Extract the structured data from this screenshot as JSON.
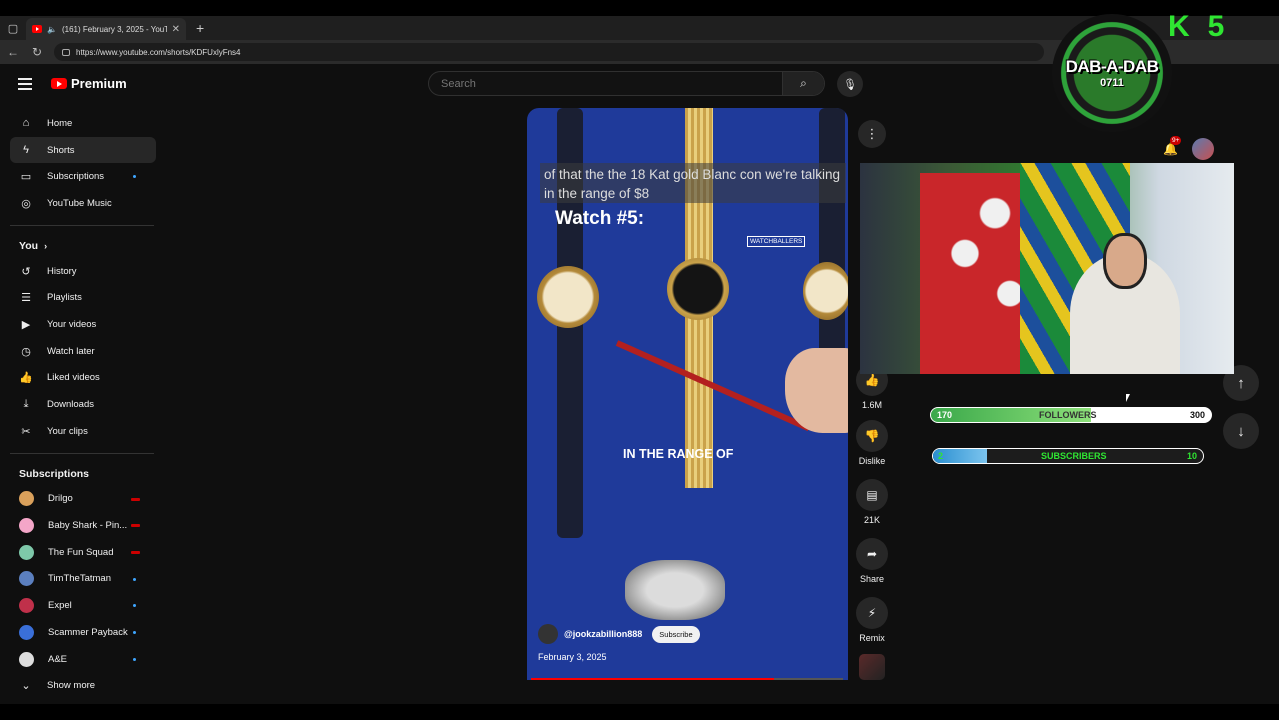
{
  "browser": {
    "tab_title": "(161) February 3, 2025 - YouT",
    "url": "https://www.youtube.com/shorts/KDFUxlyFns4"
  },
  "header": {
    "logo_text": "Premium",
    "search_placeholder": "Search"
  },
  "sidebar": {
    "main": [
      {
        "label": "Home",
        "icon": "home-icon"
      },
      {
        "label": "Shorts",
        "icon": "shorts-icon",
        "active": true
      },
      {
        "label": "Subscriptions",
        "icon": "subscriptions-icon"
      },
      {
        "label": "YouTube Music",
        "icon": "music-icon"
      }
    ],
    "you_heading": "You",
    "you": [
      {
        "label": "History",
        "icon": "history-icon"
      },
      {
        "label": "Playlists",
        "icon": "playlists-icon"
      },
      {
        "label": "Your videos",
        "icon": "your-videos-icon"
      },
      {
        "label": "Watch later",
        "icon": "watch-later-icon"
      },
      {
        "label": "Liked videos",
        "icon": "like-icon"
      },
      {
        "label": "Downloads",
        "icon": "download-icon"
      },
      {
        "label": "Your clips",
        "icon": "scissors-icon"
      }
    ],
    "subs_heading": "Subscriptions",
    "subscriptions": [
      {
        "label": "Drilgo",
        "color": "#d9a05b",
        "status": "live"
      },
      {
        "label": "Baby Shark - Pin...",
        "color": "#f4a6c8",
        "status": "live"
      },
      {
        "label": "The Fun Squad",
        "color": "#7ec8a9",
        "status": "live"
      },
      {
        "label": "TimTheTatman",
        "color": "#5b7fbf",
        "status": "new"
      },
      {
        "label": "Expel",
        "color": "#c0304a",
        "status": "new"
      },
      {
        "label": "Scammer Payback",
        "color": "#3a6fd8",
        "status": "new"
      },
      {
        "label": "A&E",
        "color": "#dddddd",
        "status": "new"
      }
    ],
    "show_more": "Show more"
  },
  "short": {
    "caption": "of that the the 18 Kat gold Blanc con we're talking in the range of $8",
    "title_overlay": "Watch #5:",
    "brand_overlay": "WATCHBALLERS",
    "subtitle_overlay": "IN THE RANGE OF",
    "channel": "@jookzabillion888",
    "subscribe_label": "Subscribe",
    "date": "February 3, 2025",
    "progress": 0.78
  },
  "actions": {
    "likes": "1.6M",
    "dislike": "Dislike",
    "comments": "21K",
    "share": "Share",
    "remix": "Remix"
  },
  "overlay": {
    "logo_line1": "DAB-A-DAB",
    "logo_line2": "0711",
    "corner_text": "K5",
    "followers": {
      "current": "170",
      "label": "FOLLOWERS",
      "goal": "300",
      "fraction": 0.57
    },
    "subscribers": {
      "current": "2",
      "label": "SUBSCRIBERS",
      "goal": "10",
      "fraction": 0.2
    }
  },
  "notifications_badge": "9+"
}
